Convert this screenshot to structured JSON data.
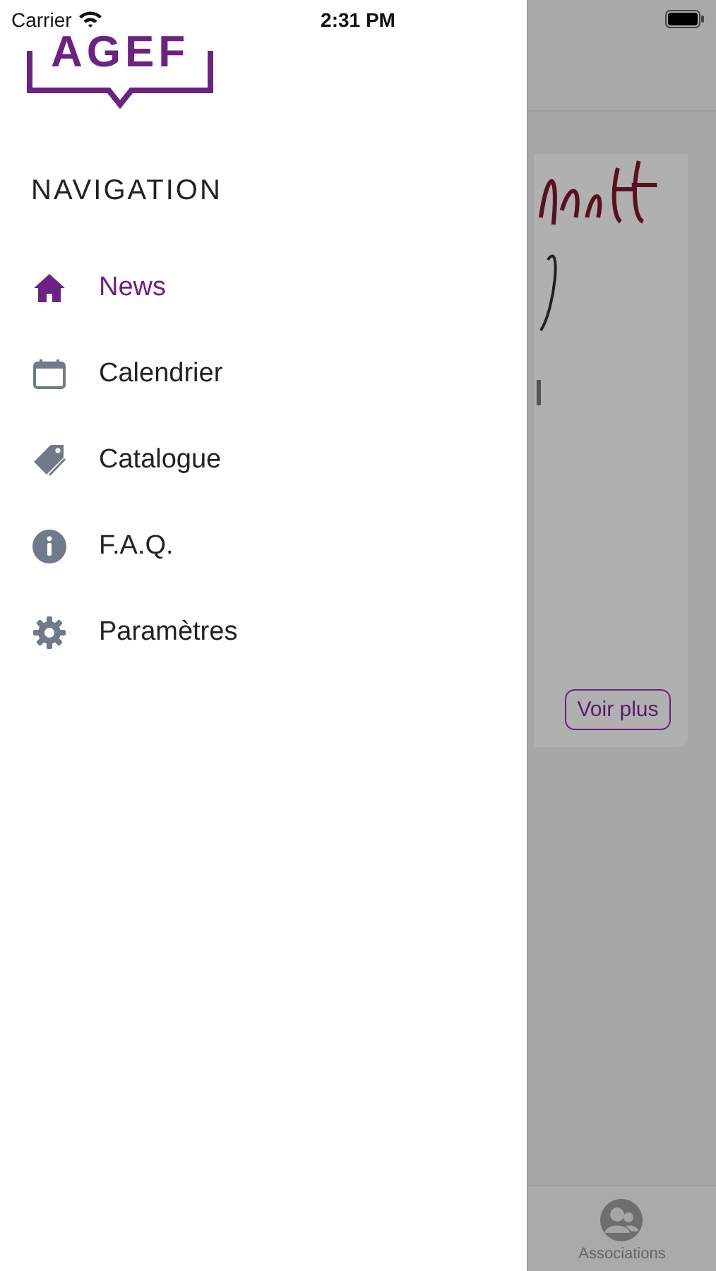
{
  "status_bar": {
    "carrier": "Carrier",
    "time": "2:31 PM"
  },
  "logo": {
    "text": "AGEF"
  },
  "navigation": {
    "heading": "NAVIGATION",
    "items": [
      {
        "label": "News",
        "kind": "home",
        "selected": true
      },
      {
        "label": "Calendrier",
        "kind": "calendar",
        "selected": false
      },
      {
        "label": "Catalogue",
        "kind": "tag",
        "selected": false
      },
      {
        "label": "F.A.Q.",
        "kind": "info",
        "selected": false
      },
      {
        "label": "Paramètres",
        "kind": "gear",
        "selected": false
      }
    ]
  },
  "background": {
    "card": {
      "button": "Voir plus"
    },
    "tab_bar": [
      {
        "label": "Associations"
      }
    ]
  }
}
